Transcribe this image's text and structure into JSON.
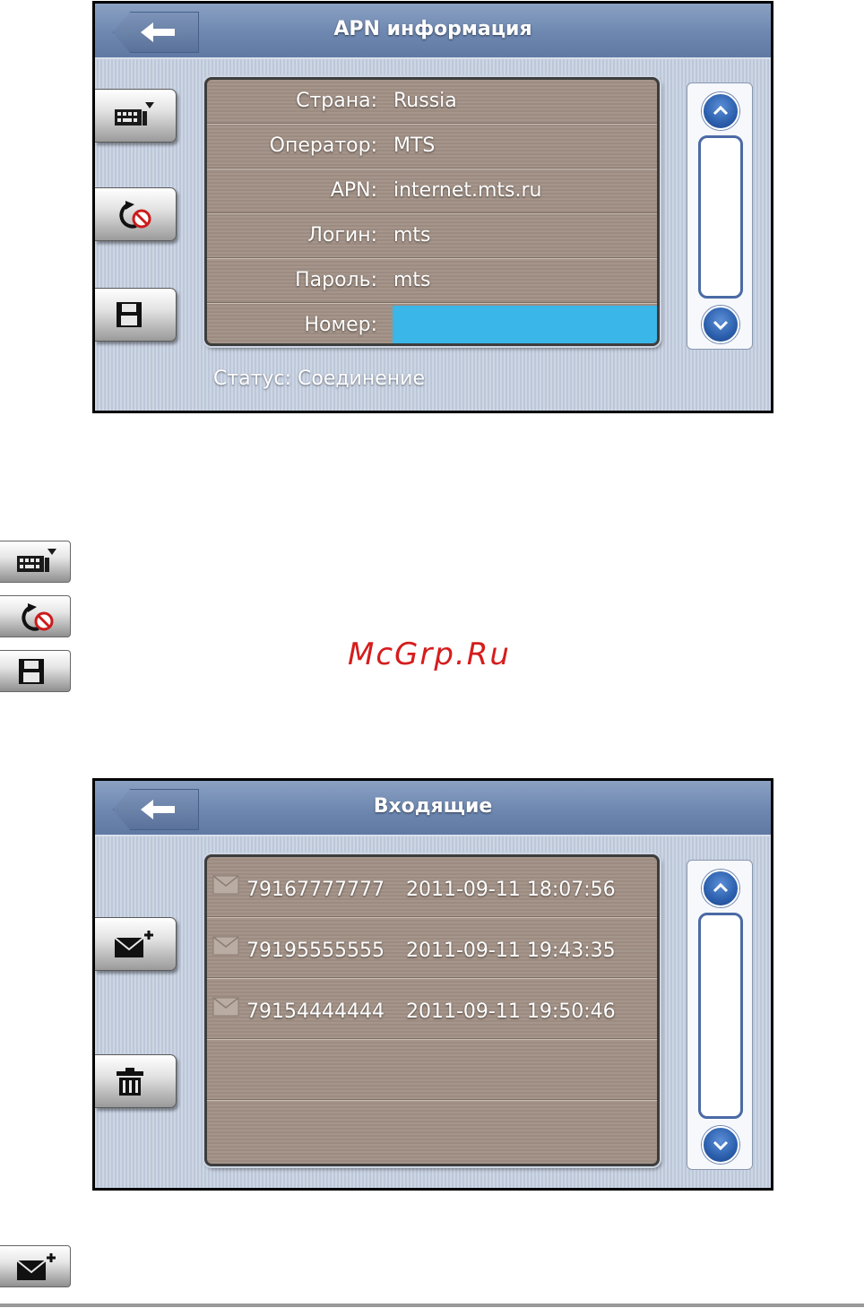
{
  "apn_screen": {
    "title": "APN информация",
    "rows": [
      {
        "label": "Страна:",
        "value": "Russia"
      },
      {
        "label": "Оператор:",
        "value": "MTS"
      },
      {
        "label": "APN:",
        "value": "internet.mts.ru"
      },
      {
        "label": "Логин:",
        "value": "mts"
      },
      {
        "label": "Пароль:",
        "value": "mts"
      }
    ],
    "number_row": {
      "label": "Номер:",
      "value": ""
    },
    "status": "Статус: Соединение",
    "buttons": [
      "keyboard-icon",
      "connect-cancel-icon",
      "save-icon"
    ],
    "accent": "#3ab6e8"
  },
  "inbox_screen": {
    "title": "Входящие",
    "messages": [
      {
        "number": "79167777777",
        "datetime": "2011-09-11 18:07:56"
      },
      {
        "number": "79195555555",
        "datetime": "2011-09-11 19:43:35"
      },
      {
        "number": "79154444444",
        "datetime": "2011-09-11 19:50:46"
      }
    ],
    "buttons": [
      "new-message-icon",
      "trash-icon"
    ]
  },
  "watermark": "McGrp.Ru",
  "colors": {
    "header": "#6d87b0",
    "panel": "#a5958a",
    "scroll": "#2b5fad",
    "watermark": "#d51d1d"
  }
}
